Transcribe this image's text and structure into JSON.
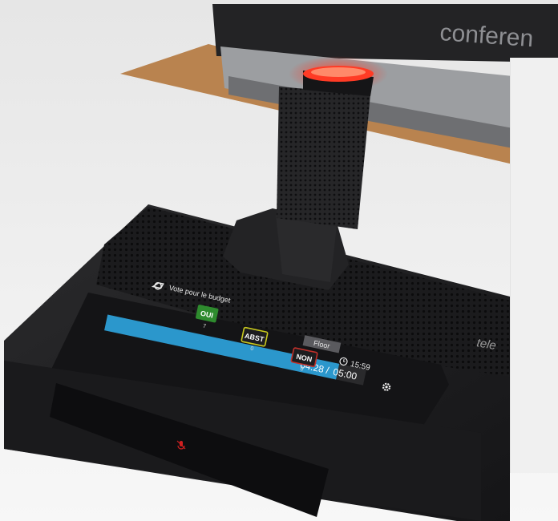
{
  "scene": {
    "background_monitor_text": "conferen",
    "device_brand_text": "tele"
  },
  "vote_screen": {
    "title": "Vote pour le budget",
    "floor_label": "Floor",
    "time": "15:59",
    "progress_elapsed": "04:28",
    "progress_separator": "/",
    "progress_total": "05:00",
    "progress_fraction": 0.895,
    "options": [
      {
        "label": "OUI",
        "count": "7",
        "color": "#2e8b2e"
      },
      {
        "label": "ABST",
        "count": "0",
        "color": "#c8c81e"
      },
      {
        "label": "NON",
        "count": "0",
        "color": "#c0302a"
      }
    ],
    "icons": {
      "title_icon": "vote-icon",
      "clock_icon": "clock-icon",
      "settings_icon": "gear-icon",
      "mic_mute_icon": "mic-muted-icon"
    },
    "colors": {
      "progress": "#2b97cc",
      "mic_led": "#ff2a1a"
    }
  }
}
